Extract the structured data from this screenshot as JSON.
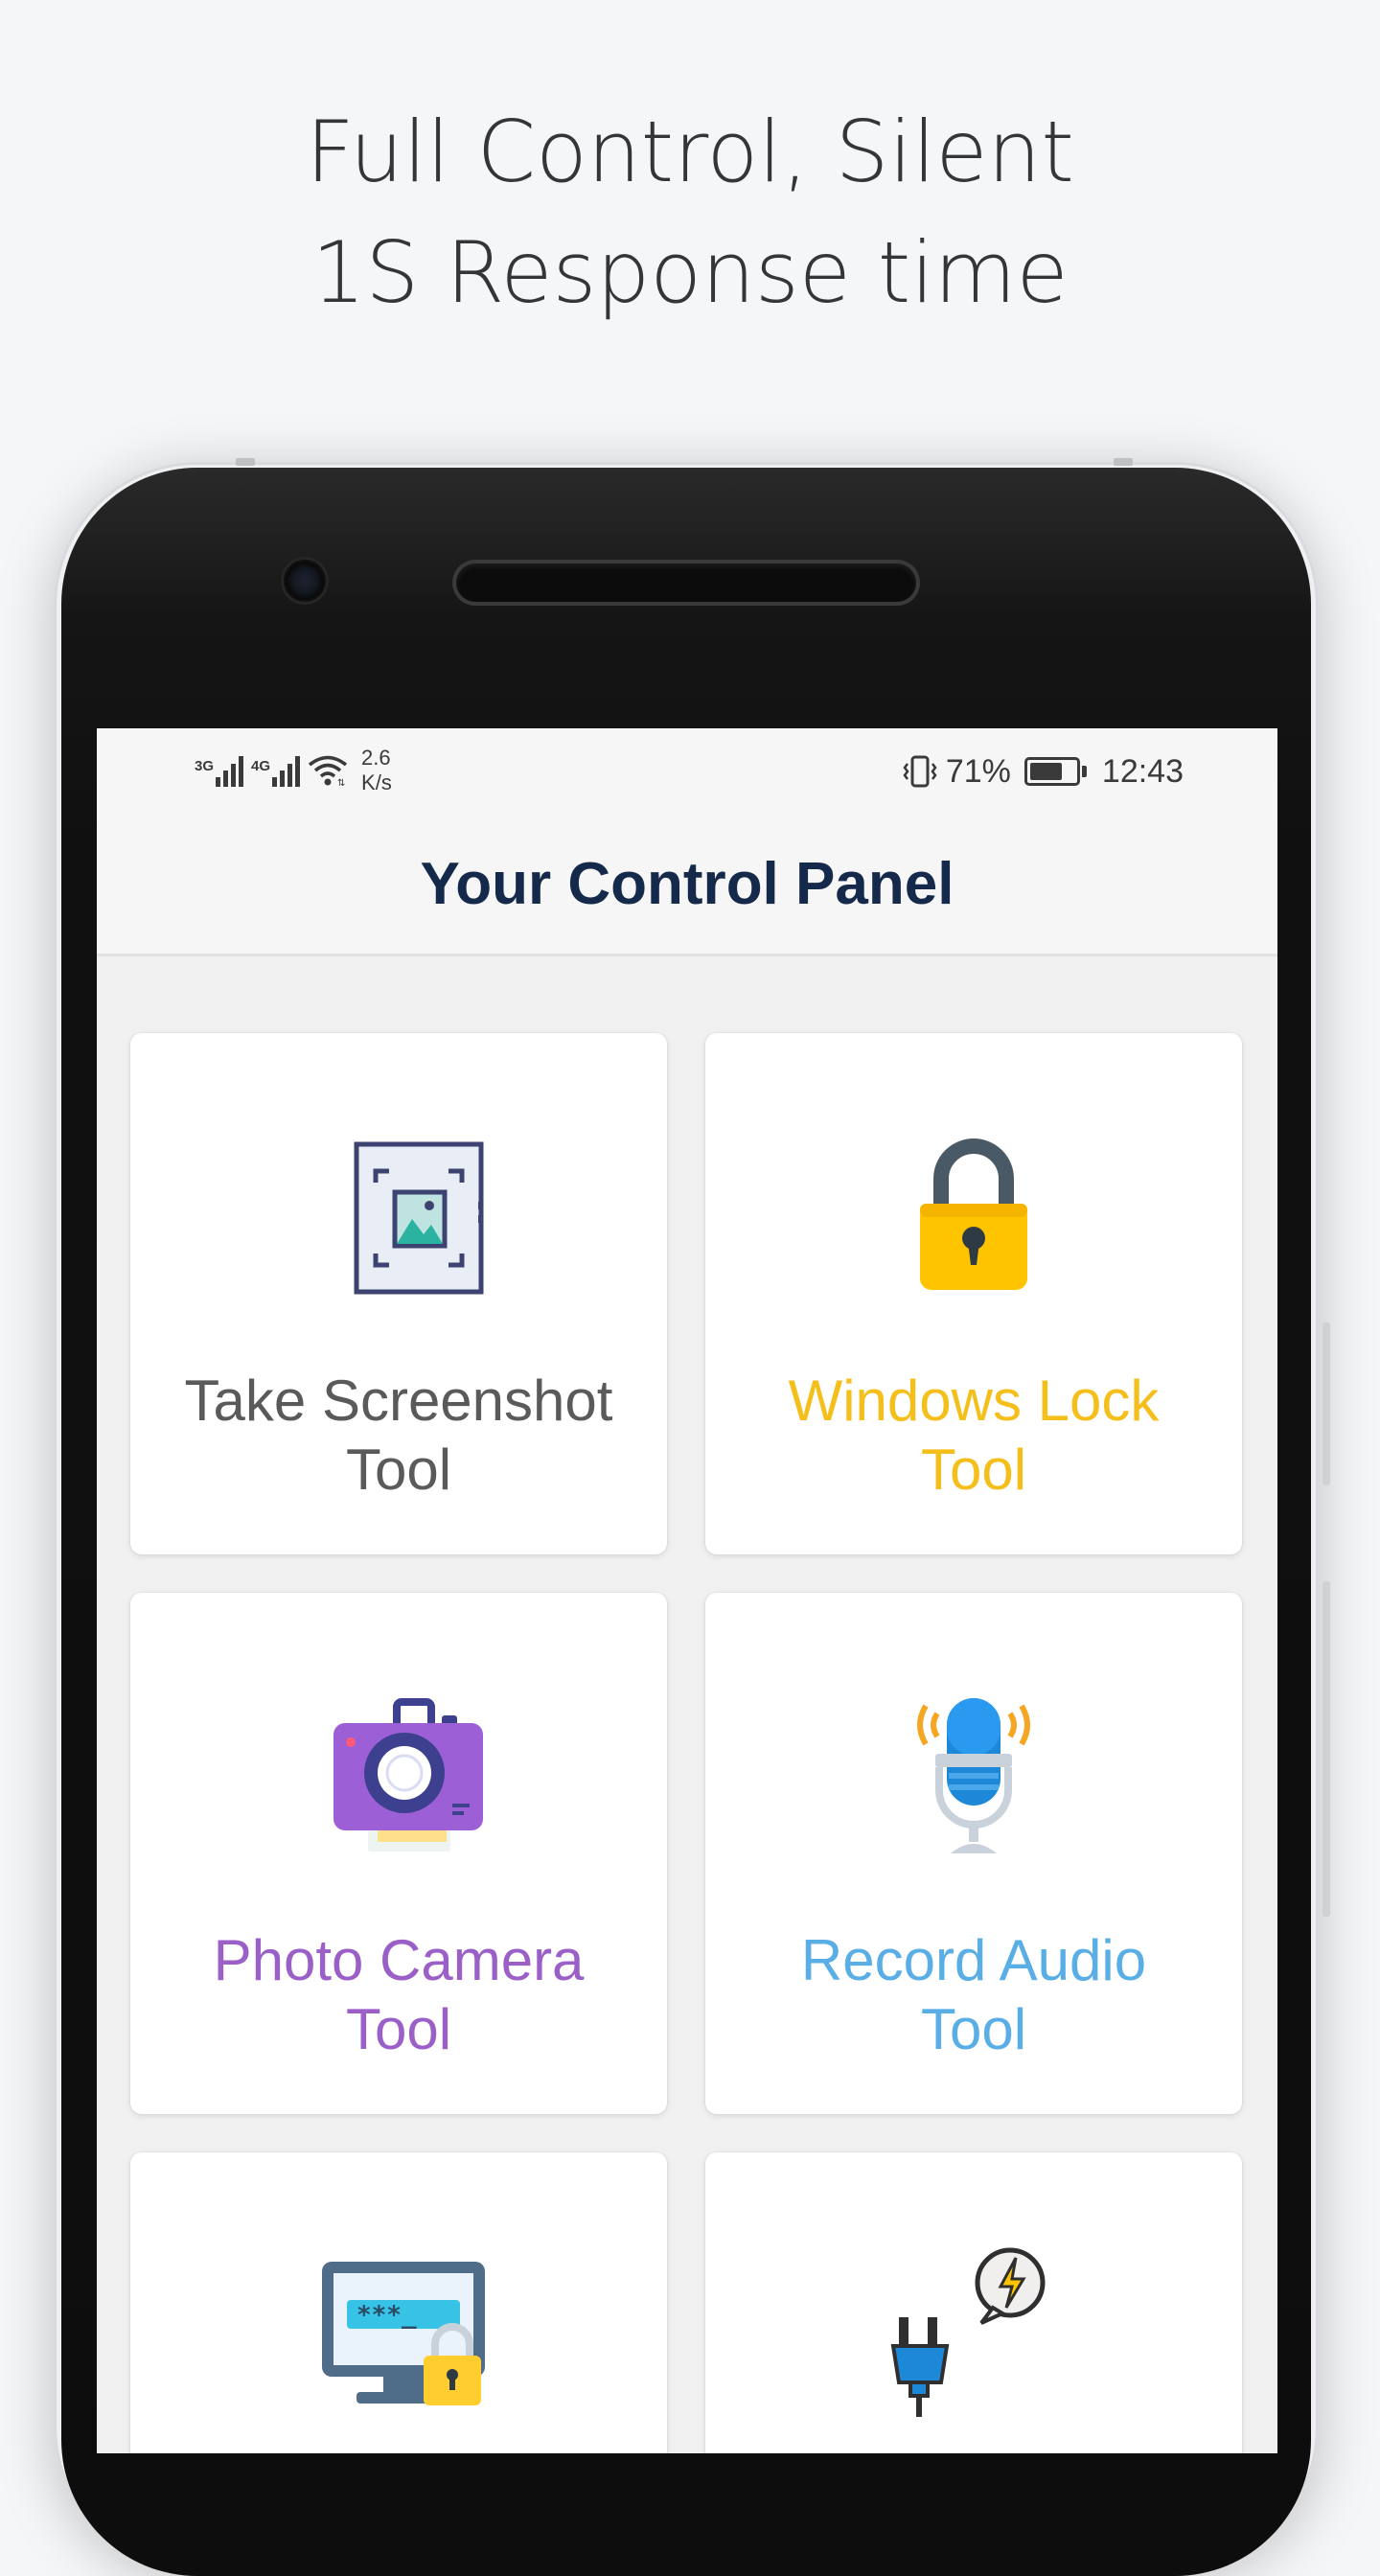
{
  "headline": {
    "line1": "Full Control, Silent",
    "line2": "1S Response time"
  },
  "status_bar": {
    "network1": "3G",
    "network2": "4G",
    "speed_value": "2.6",
    "speed_unit": "K/s",
    "battery_percent": "71%",
    "battery_level": 0.71,
    "time": "12:43"
  },
  "app_bar": {
    "title": "Your Control Panel"
  },
  "tools": [
    {
      "label_line1": "Take Screenshot",
      "label_line2": "Tool",
      "color": "#5a5a5a",
      "icon": "screenshot-icon"
    },
    {
      "label_line1": "Windows Lock",
      "label_line2": "Tool",
      "color": "#f5bf1b",
      "icon": "padlock-icon"
    },
    {
      "label_line1": "Photo Camera",
      "label_line2": "Tool",
      "color": "#9b5fc8",
      "icon": "camera-icon"
    },
    {
      "label_line1": "Record Audio",
      "label_line2": "Tool",
      "color": "#5aaee6",
      "icon": "microphone-icon"
    },
    {
      "label_line1": "",
      "label_line2": "",
      "color": "#4a6c8c",
      "icon": "password-monitor-icon"
    },
    {
      "label_line1": "",
      "label_line2": "",
      "color": "#1e88d8",
      "icon": "power-plug-icon"
    }
  ]
}
